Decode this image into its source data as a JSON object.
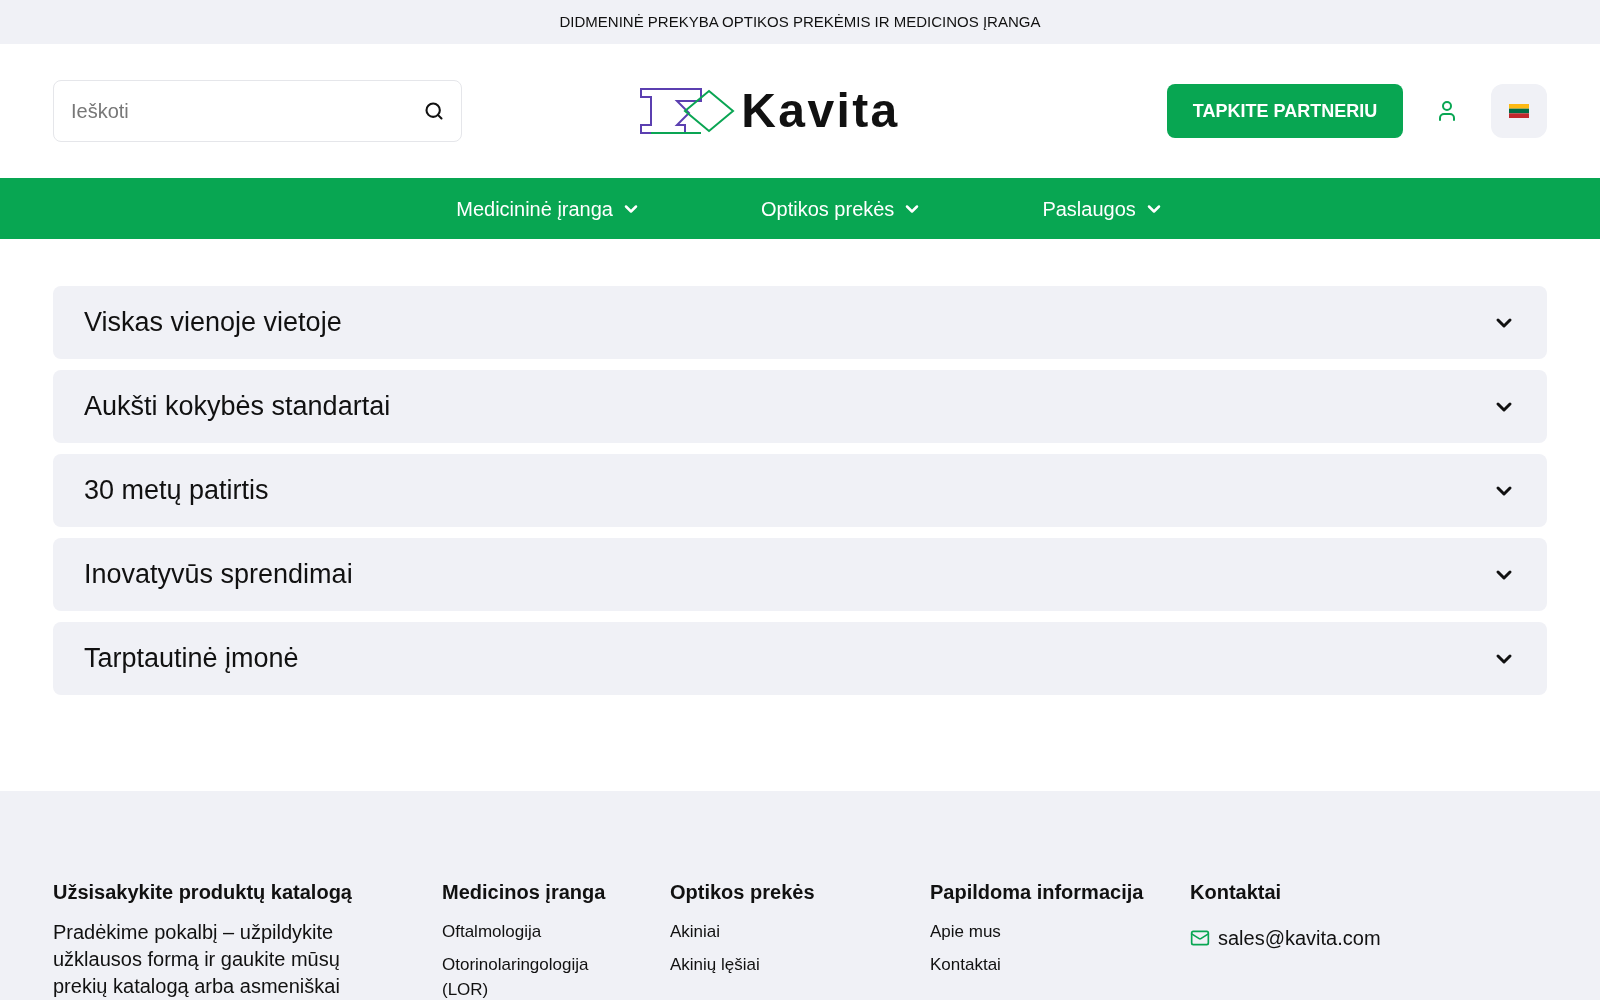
{
  "top_bar": {
    "text": "DIDMENINĖ PREKYBA OPTIKOS PREKĖMIS IR MEDICINOS ĮRANGA"
  },
  "header": {
    "search": {
      "placeholder": "Ieškoti"
    },
    "logo": {
      "text": "Kavita"
    },
    "partner_button": "TAPKITE PARTNERIU"
  },
  "nav": [
    {
      "label": "Medicininė įranga",
      "expanded": false
    },
    {
      "label": "Optikos prekės",
      "expanded": false
    },
    {
      "label": "Paslaugos",
      "expanded": false
    }
  ],
  "accordion": [
    {
      "title": "Viskas vienoje vietoje",
      "expanded": false
    },
    {
      "title": "Aukšti kokybės standartai",
      "expanded": false
    },
    {
      "title": "30 metų patirtis",
      "expanded": false
    },
    {
      "title": "Inovatyvūs sprendimai",
      "expanded": false
    },
    {
      "title": "Tarptautinė įmonė",
      "expanded": false
    }
  ],
  "footer": {
    "catalog": {
      "title": "Užsisakykite produktų katalogą",
      "text": "Pradėkime pokalbį – užpildykite užklausos formą ir gaukite mūsų prekių katalogą arba asmeniškai"
    },
    "columns": [
      {
        "title": "Medicinos įranga",
        "links": [
          "Oftalmologija",
          "Otorinolaringologija (LOR)"
        ]
      },
      {
        "title": "Optikos prekės",
        "links": [
          "Akiniai",
          "Akinių lęšiai"
        ]
      },
      {
        "title": "Papildoma informacija",
        "links": [
          "Apie mus",
          "Kontaktai"
        ]
      }
    ],
    "contacts": {
      "title": "Kontaktai",
      "email": "sales@kavita.com"
    }
  }
}
